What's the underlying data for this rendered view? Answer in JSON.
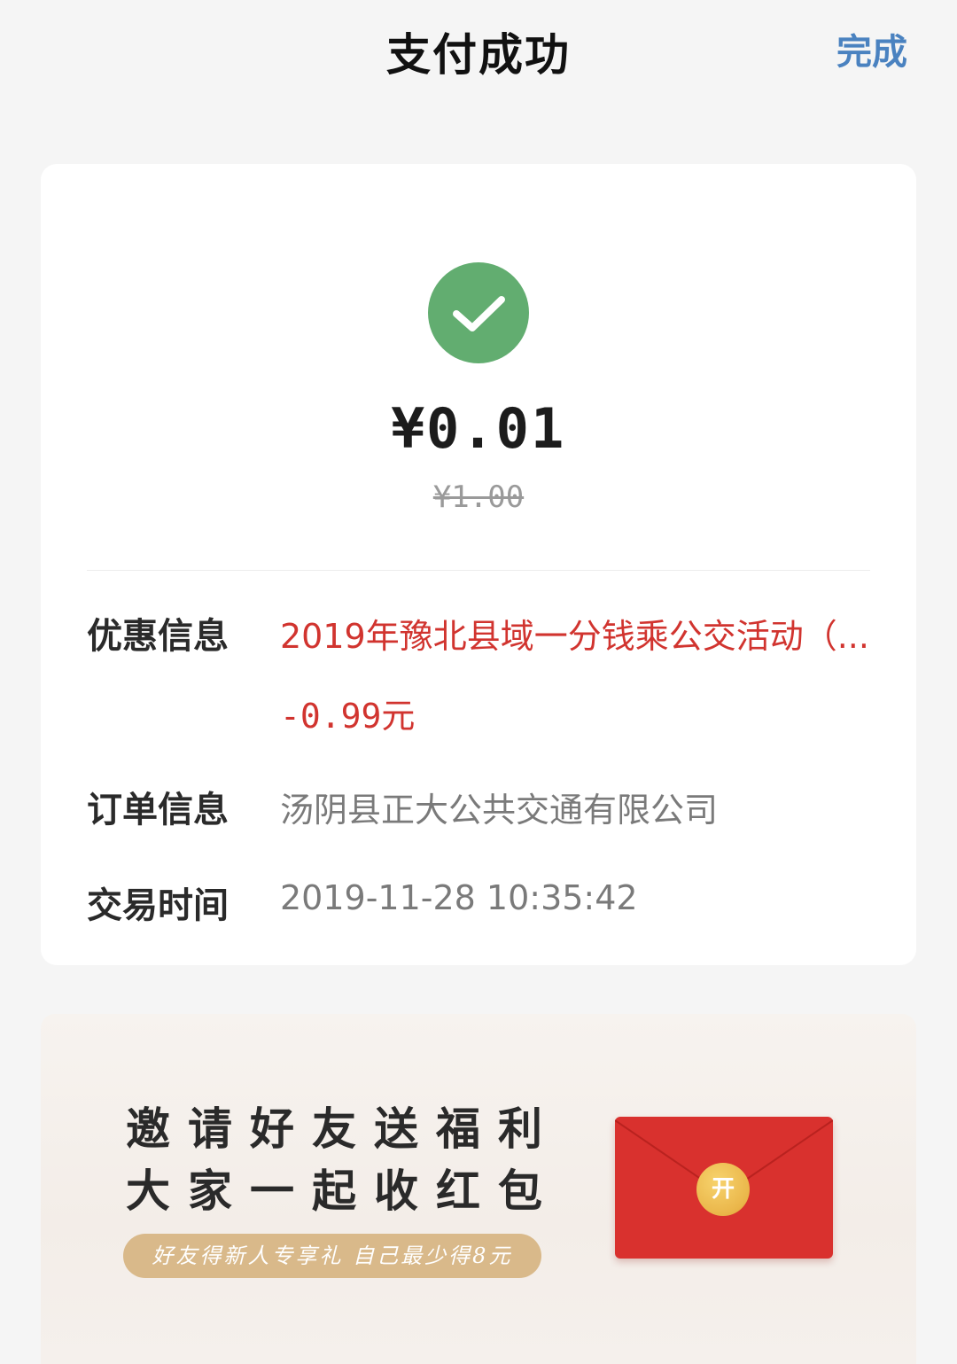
{
  "header": {
    "title": "支付成功",
    "done_label": "完成"
  },
  "payment": {
    "amount": "¥0.01",
    "original_amount": "¥1.00",
    "status_icon": "check-icon",
    "status_color": "#62ad70"
  },
  "details": {
    "promo": {
      "label": "优惠信息",
      "text": "2019年豫北县域一分钱乘公交活动（...",
      "discount": "-0.99元"
    },
    "order": {
      "label": "订单信息",
      "merchant": "汤阴县正大公共交通有限公司"
    },
    "time": {
      "label": "交易时间",
      "value": "2019-11-28 10:35:42"
    }
  },
  "banner": {
    "line1": "邀请好友送福利",
    "line2": "大家一起收红包",
    "subtitle": "好友得新人专享礼 自己最少得8元",
    "envelope_label": "开",
    "envelope_color": "#d9312e"
  },
  "colors": {
    "accent": "#4a82c0",
    "promo_red": "#d1342f",
    "background": "#f5f5f5"
  }
}
